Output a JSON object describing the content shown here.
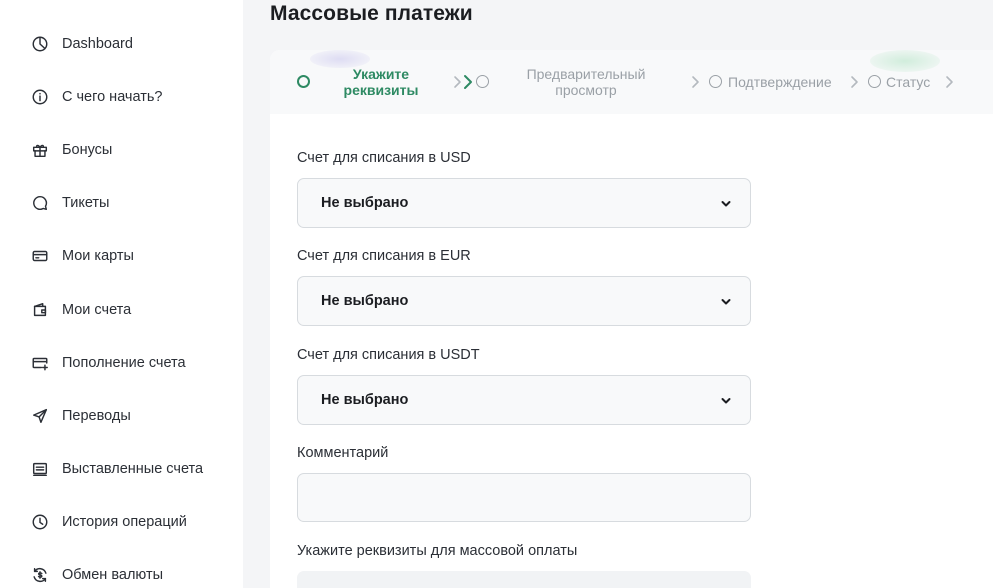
{
  "sidebar": {
    "items": [
      {
        "label": "Dashboard",
        "icon": "dashboard-pie-icon"
      },
      {
        "label": "С чего начать?",
        "icon": "info-icon"
      },
      {
        "label": "Бонусы",
        "icon": "gift-icon"
      },
      {
        "label": "Тикеты",
        "icon": "chat-bubble-icon"
      },
      {
        "label": "Мои карты",
        "icon": "card-icon"
      },
      {
        "label": "Мои счета",
        "icon": "wallet-icon"
      },
      {
        "label": "Пополнение счета",
        "icon": "card-add-icon"
      },
      {
        "label": "Переводы",
        "icon": "send-icon"
      },
      {
        "label": "Выставленные счета",
        "icon": "invoice-icon"
      },
      {
        "label": "История операций",
        "icon": "clock-icon"
      },
      {
        "label": "Обмен валюты",
        "icon": "exchange-icon"
      }
    ]
  },
  "page": {
    "title": "Массовые платежи"
  },
  "stepper": {
    "steps": [
      {
        "label": "Укажите реквизиты",
        "active": true
      },
      {
        "label": "Предварительный просмотр",
        "active": false
      },
      {
        "label": "Подтверждение",
        "active": false
      },
      {
        "label": "Статус",
        "active": false
      }
    ]
  },
  "form": {
    "usd_label": "Счет для списания в USD",
    "usd_value": "Не выбрано",
    "eur_label": "Счет для списания в EUR",
    "eur_value": "Не выбрано",
    "usdt_label": "Счет для списания в USDT",
    "usdt_value": "Не выбрано",
    "comment_label": "Комментарий",
    "comment_value": "",
    "details_label": "Укажите реквизиты для массовой оплаты"
  },
  "colors": {
    "accent": "#2e8a63",
    "inactive": "#9aa0a6",
    "background": "#f4f5f7"
  }
}
